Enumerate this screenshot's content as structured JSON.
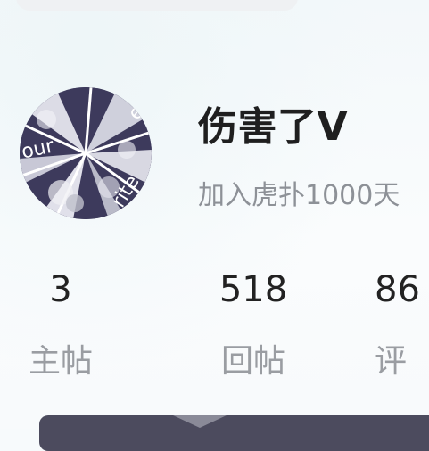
{
  "profile": {
    "username": "伤害了V",
    "joined": "加入虎扑1000天",
    "avatar_icon": "avatar-image"
  },
  "stats": [
    {
      "value": "3",
      "label": "主帖"
    },
    {
      "value": "518",
      "label": "回帖"
    },
    {
      "value": "86",
      "label": "评"
    }
  ],
  "colors": {
    "username": "#1f1f1f",
    "subtext": "#8d9197",
    "avatar_bg": "#3d3a5c",
    "bottom_bar": "#4c4b5e"
  }
}
